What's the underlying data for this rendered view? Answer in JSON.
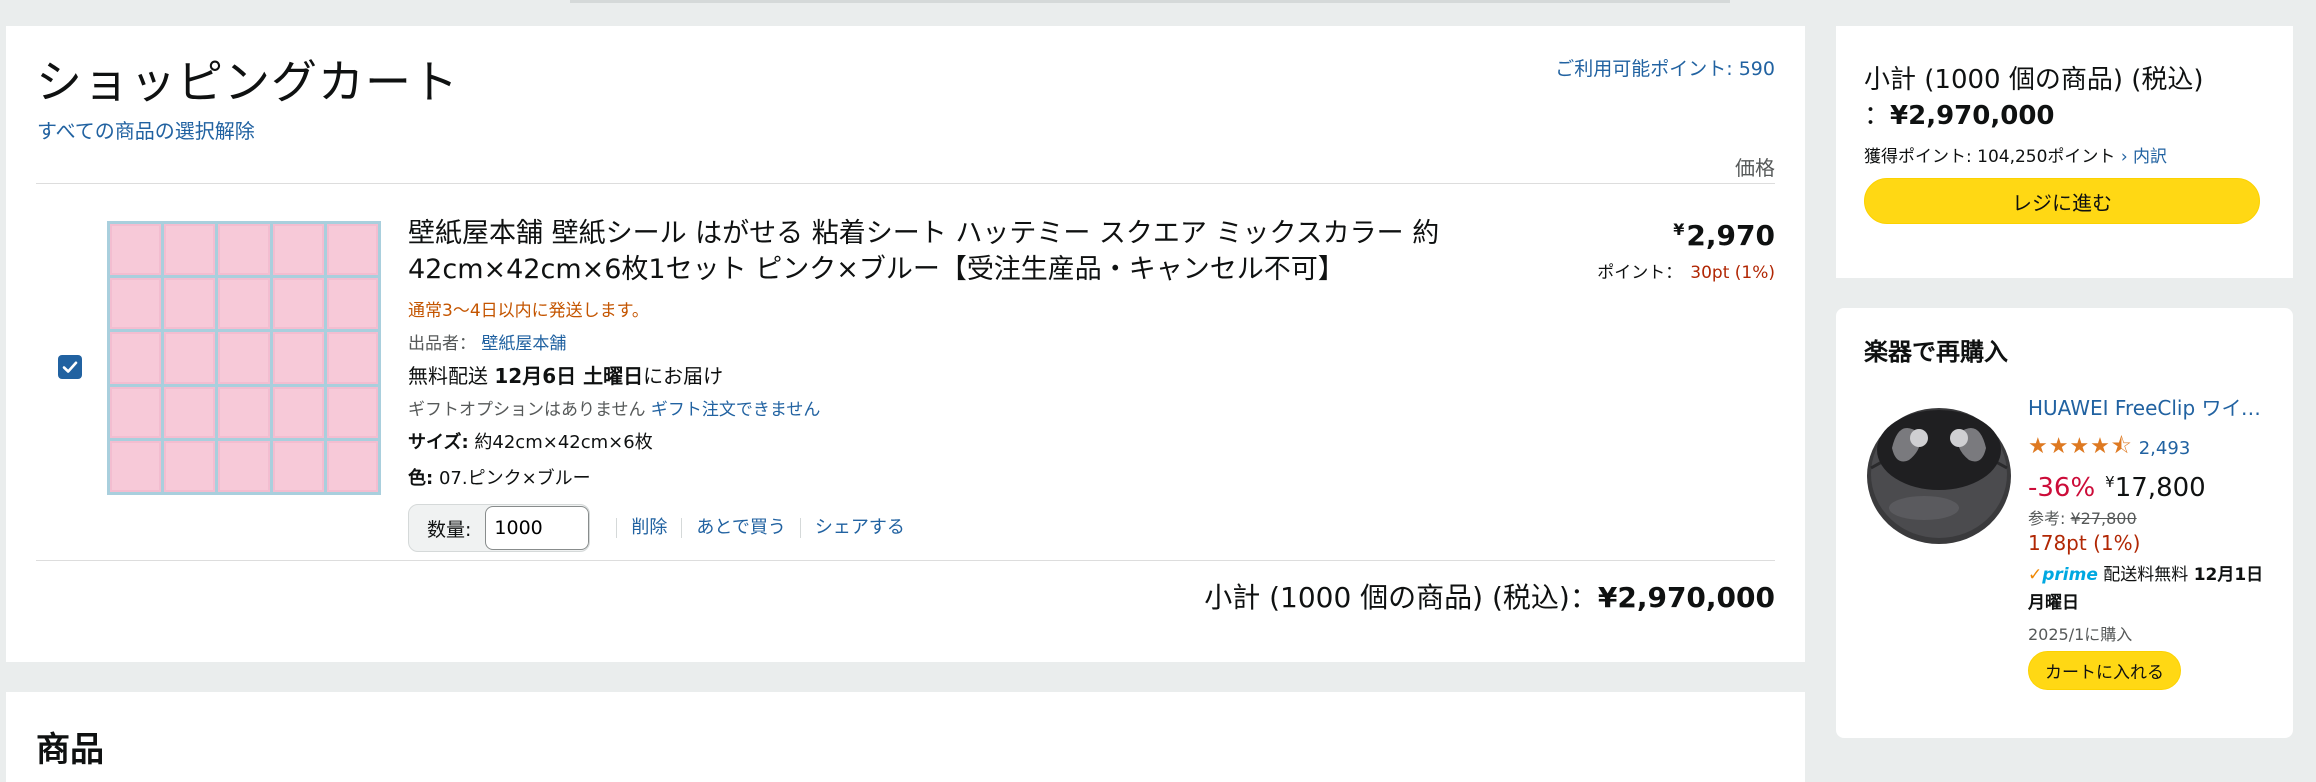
{
  "cart": {
    "title": "ショッピングカート",
    "deselect_all": "すべての商品の選択解除",
    "points_available": "ご利用可能ポイント: 590",
    "price_header": "価格",
    "item": {
      "title": "壁紙屋本舗 壁紙シール はがせる 粘着シート ハッテミー スクエア ミックスカラー 約42cm×42cm×6枚1セット ピンク×ブルー【受注生産品・キャンセル不可】",
      "ship_notice": "通常3～4日以内に発送します。",
      "seller_label": "出品者：",
      "seller_name": "壁紙屋本舗",
      "delivery_prefix": "無料配送",
      "delivery_date": "12月6日 土曜日",
      "delivery_suffix": "にお届け",
      "gift_text": "ギフトオプションはありません",
      "gift_link": "ギフト注文できません",
      "size_label": "サイズ:",
      "size_value": "約42cm×42cm×6枚",
      "color_label": "色:",
      "color_value": "07.ピンク×ブルー",
      "qty_label": "数量:",
      "qty_value": "1000",
      "delete": "削除",
      "save_later": "あとで買う",
      "share": "シェアする",
      "price_symbol": "¥",
      "price": "2,970",
      "points_label": "ポイント：",
      "points_value": "30pt (1%)",
      "checked": true
    },
    "subtotal_label": "小計 (1000 個の商品) (税込)：",
    "subtotal_value": "¥2,970,000"
  },
  "products_section": {
    "title": "商品"
  },
  "checkout": {
    "subtotal_label": "小計 (1000 個の商品) (税込)",
    "subtotal_sep": "：",
    "subtotal_value": "¥2,970,000",
    "earn_points": "獲得ポイント: 104,250ポイント",
    "breakdown_link": "› 内訳",
    "proceed_button": "レジに進む"
  },
  "rebuy": {
    "title": "楽器で再購入",
    "product_name": "HUAWEI FreeClip ワイヤレスイヤホン",
    "rating_stars": "★★★★⯪",
    "rating_count": "2,493",
    "discount": "-36%",
    "price_symbol": "¥",
    "price": "17,800",
    "ref_label": "参考:",
    "ref_price": "¥27,800",
    "points": "178pt (1%)",
    "prime_check": "✓",
    "prime_label": "prime",
    "shipping_text": "配送料無料",
    "shipping_date": "12月1日 月曜日",
    "bought_on": "2025/1に購入",
    "add_to_cart": "カートに入れる"
  },
  "colors": {
    "link": "#2162a1",
    "button_yellow": "#ffd814",
    "price_red": "#b12704",
    "discount_red": "#cc0c39",
    "ship_orange": "#c45500",
    "star_orange": "#de7921",
    "tile_pink": "#f7c9d8",
    "tile_grout": "#a9cfdd"
  }
}
